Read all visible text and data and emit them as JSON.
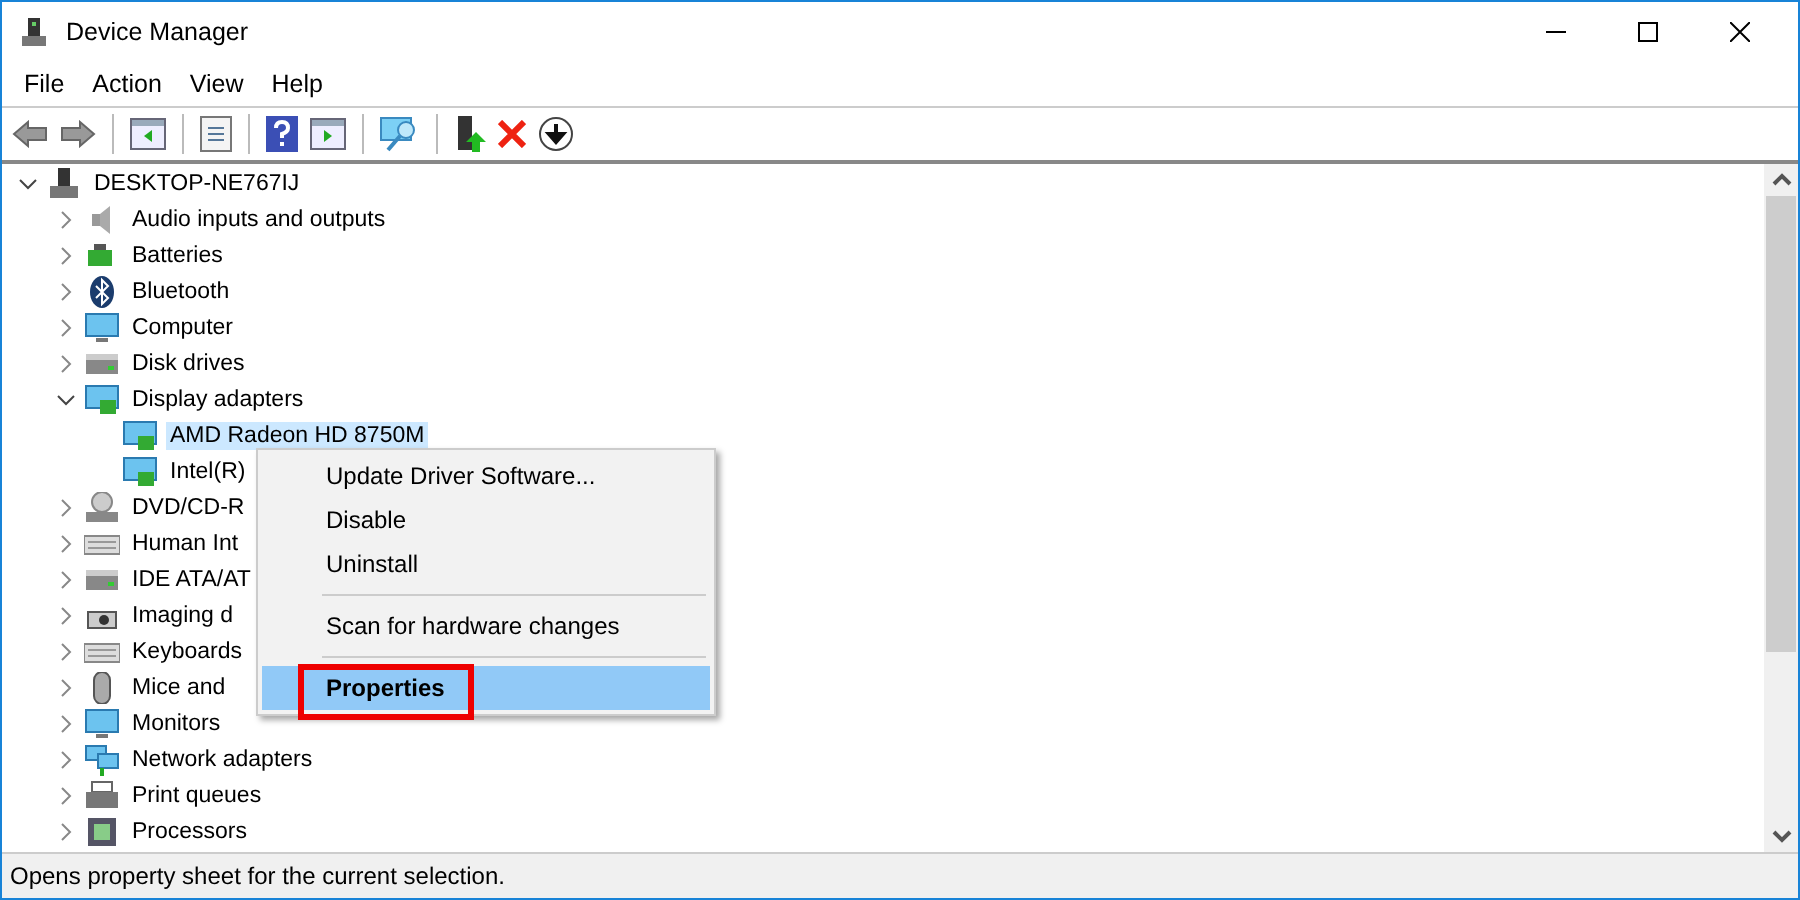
{
  "window": {
    "title": "Device Manager"
  },
  "menu_bar": [
    "File",
    "Action",
    "View",
    "Help"
  ],
  "tree": [
    {
      "label": "DESKTOP-NE767IJ",
      "expanded": true,
      "selected": false,
      "children": [
        {
          "label": "Audio inputs and outputs",
          "expanded": false,
          "selected": false
        },
        {
          "label": "Batteries",
          "expanded": false,
          "selected": false
        },
        {
          "label": "Bluetooth",
          "expanded": false,
          "selected": false
        },
        {
          "label": "Computer",
          "expanded": false,
          "selected": false
        },
        {
          "label": "Disk drives",
          "expanded": false,
          "selected": false
        },
        {
          "label": "Display adapters",
          "expanded": true,
          "selected": false,
          "children": [
            {
              "label": "AMD Radeon HD 8750M",
              "selected": true
            },
            {
              "label": "Intel(R)",
              "selected": false
            }
          ]
        },
        {
          "label": "DVD/CD-R",
          "expanded": false,
          "selected": false
        },
        {
          "label": "Human Int",
          "expanded": false,
          "selected": false
        },
        {
          "label": "IDE ATA/AT",
          "expanded": false,
          "selected": false
        },
        {
          "label": "Imaging d",
          "expanded": false,
          "selected": false
        },
        {
          "label": "Keyboards",
          "expanded": false,
          "selected": false
        },
        {
          "label": "Mice and",
          "expanded": false,
          "selected": false
        },
        {
          "label": "Monitors",
          "expanded": false,
          "selected": false
        },
        {
          "label": "Network adapters",
          "expanded": false,
          "selected": false
        },
        {
          "label": "Print queues",
          "expanded": false,
          "selected": false
        },
        {
          "label": "Processors",
          "expanded": false,
          "selected": false
        }
      ]
    }
  ],
  "context_menu": [
    {
      "kind": "item",
      "label": "Update Driver Software...",
      "selected": false
    },
    {
      "kind": "item",
      "label": "Disable",
      "selected": false
    },
    {
      "kind": "item",
      "label": "Uninstall",
      "selected": false
    },
    {
      "kind": "separator"
    },
    {
      "kind": "item",
      "label": "Scan for hardware changes",
      "selected": false
    },
    {
      "kind": "separator"
    },
    {
      "kind": "item",
      "label": "Properties",
      "selected": true,
      "annotated": true
    }
  ],
  "status_bar": "Opens property sheet for the current selection."
}
